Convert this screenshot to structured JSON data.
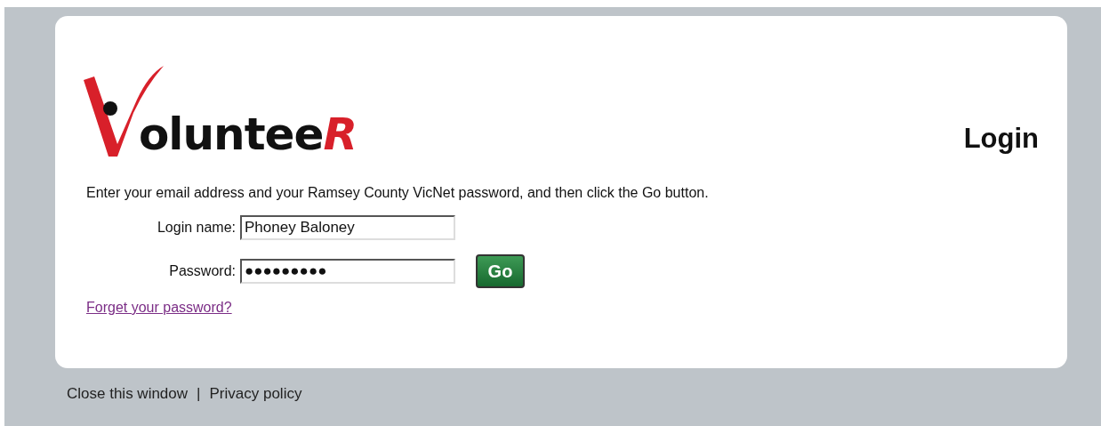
{
  "logo": {
    "text": "oluntee",
    "accent": "R"
  },
  "heading": "Login",
  "instructions": "Enter your email address and your Ramsey County VicNet password, and then click the Go button.",
  "fields": [
    {
      "label": "Login name:",
      "value": "Phoney Baloney"
    },
    {
      "label": "Password:",
      "value": "●●●●●●●●●"
    }
  ],
  "go_button": "Go",
  "forgot_link": "Forget your password?",
  "footer": {
    "links": [
      "Close this window",
      "Privacy policy"
    ],
    "separator": "|"
  }
}
